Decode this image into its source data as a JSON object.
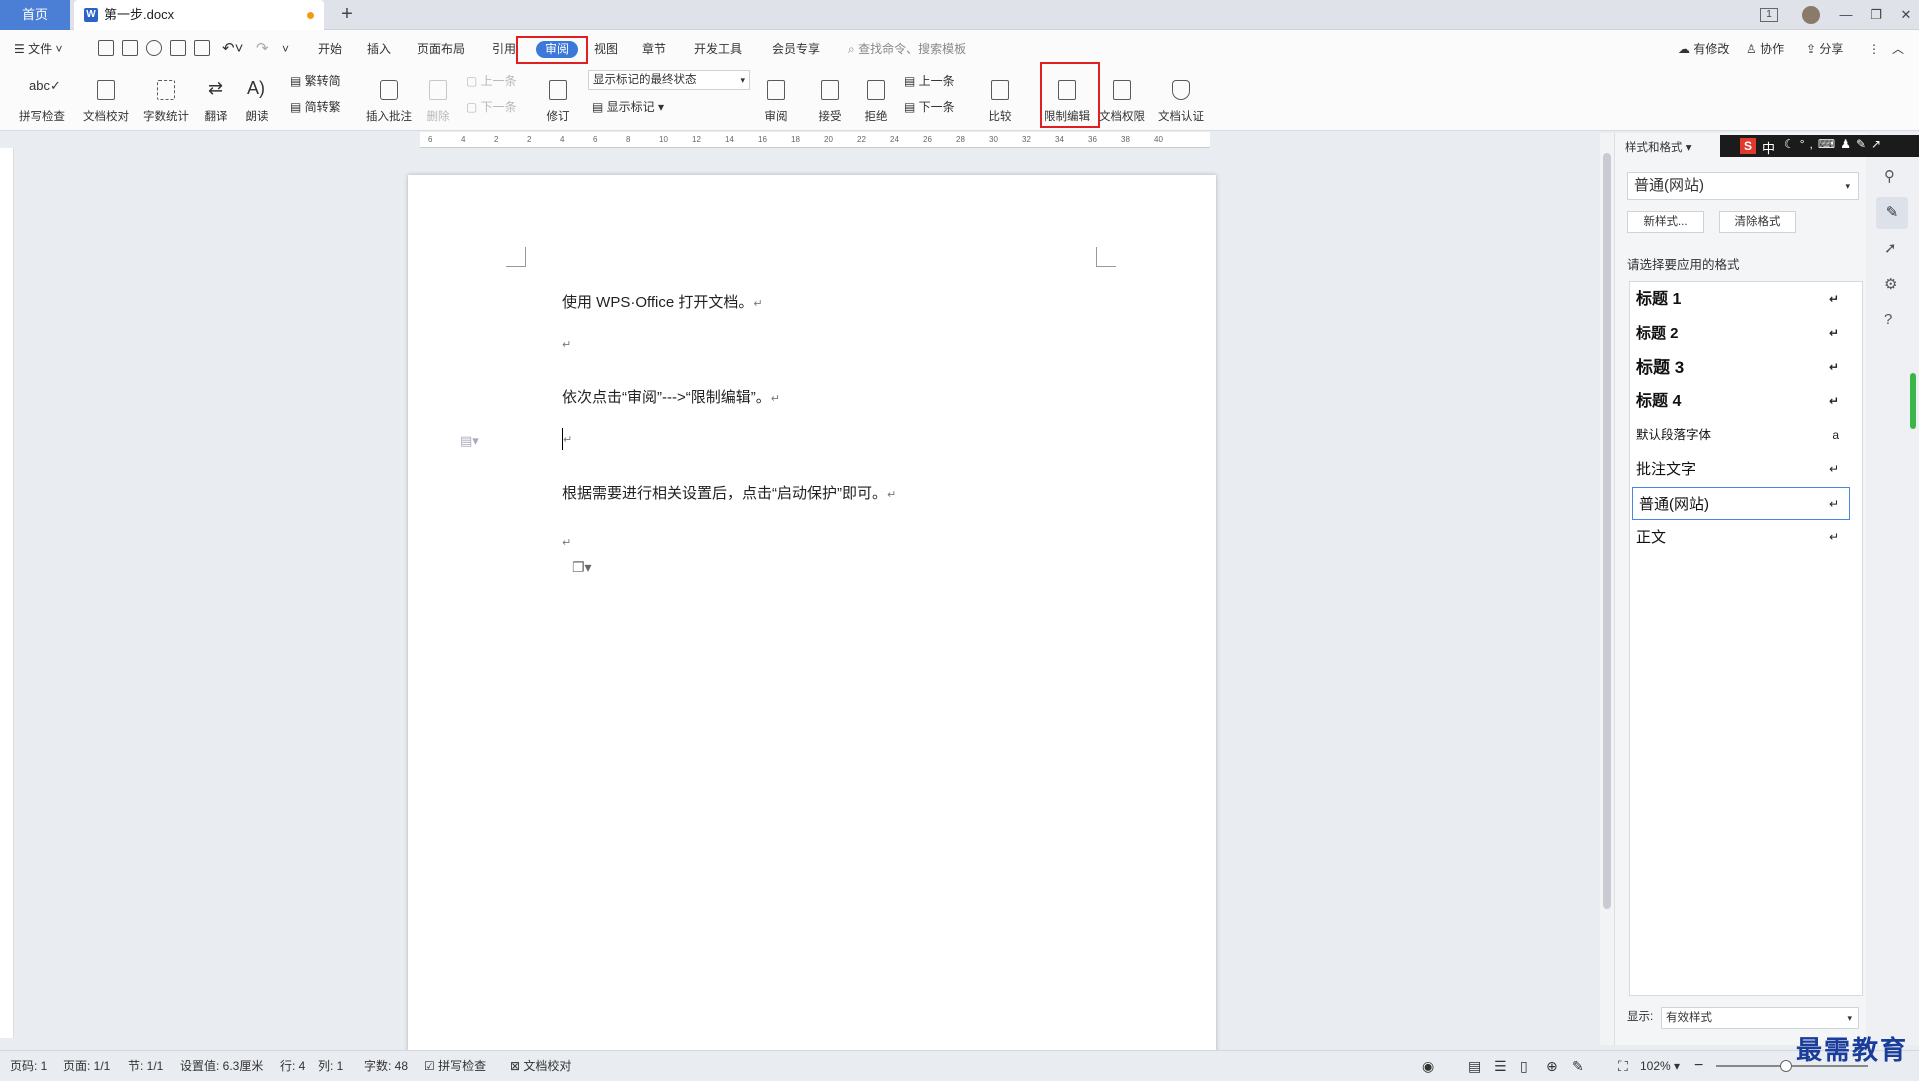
{
  "tabs": {
    "home": "首页",
    "doc": "第一步.docx",
    "doc_icon": "W",
    "new_tab": "+"
  },
  "window": {
    "box": "1",
    "min": "—",
    "restore": "❐",
    "close": "✕"
  },
  "menubar": {
    "file": "文件",
    "items": [
      "开始",
      "插入",
      "页面布局",
      "引用",
      "审阅",
      "视图",
      "章节",
      "开发工具",
      "会员专享"
    ],
    "active": "审阅",
    "search": "查找命令、搜索模板",
    "modified": "有修改",
    "collab": "协作",
    "share": "分享"
  },
  "ribbon": {
    "spell": "拼写检查",
    "proof": "文档校对",
    "wordcount": "字数统计",
    "translate": "翻译",
    "read": "朗读",
    "trad": "繁转简",
    "simp": "简转繁",
    "insert_comment": "插入批注",
    "delete": "删除",
    "prev_comment": "上一条",
    "next_comment": "下一条",
    "track": "修订",
    "markup_select": "显示标记的最终状态",
    "show_markup": "显示标记",
    "review": "审阅",
    "accept": "接受",
    "reject": "拒绝",
    "prev": "上一条",
    "next": "下一条",
    "compare": "比较",
    "restrict": "限制编辑",
    "permission": "文档权限",
    "certify": "文档认证"
  },
  "ruler": {
    "labels": [
      "6",
      "4",
      "2",
      "2",
      "4",
      "6",
      "8",
      "10",
      "12",
      "14",
      "16",
      "18",
      "20",
      "22",
      "24",
      "26",
      "28",
      "30",
      "32",
      "34",
      "36",
      "38",
      "40"
    ]
  },
  "document": {
    "lines": [
      "使用 WPS·Office 打开文档。",
      "",
      "依次点击“审阅”--->“限制编辑”。",
      "",
      "根据需要进行相关设置后，点击“启动保护”即可。",
      ""
    ],
    "para_mark": "↵"
  },
  "panel": {
    "title": "样式和格式",
    "current_style": "普通(网站)",
    "new_style": "新样式...",
    "clear_format": "清除格式",
    "choose_label": "请选择要应用的格式",
    "styles": [
      {
        "label": "标题  1",
        "mark": "↵"
      },
      {
        "label": "标题  2",
        "mark": "↵"
      },
      {
        "label": "标题  3",
        "mark": "↵"
      },
      {
        "label": "标题  4",
        "mark": "↵"
      },
      {
        "label": "默认段落字体",
        "mark": "a"
      },
      {
        "label": "批注文字",
        "mark": "↵"
      },
      {
        "label": "普通(网站)",
        "mark": "↵"
      },
      {
        "label": "正文",
        "mark": "↵"
      }
    ],
    "show_label": "显示:",
    "show_value": "有效样式"
  },
  "ime": {
    "lang": "中"
  },
  "status": {
    "page": "页码: 1",
    "pages": "页面: 1/1",
    "section": "节: 1/1",
    "setting": "设置值: 6.3厘米",
    "row": "行: 4",
    "col": "列: 1",
    "words": "字数: 48",
    "spell": "拼写检查",
    "proof": "文档校对",
    "zoom": "102%"
  },
  "watermark": "最需教育",
  "colors": {
    "accent": "#3c78d8",
    "highlight": "#e02020"
  }
}
